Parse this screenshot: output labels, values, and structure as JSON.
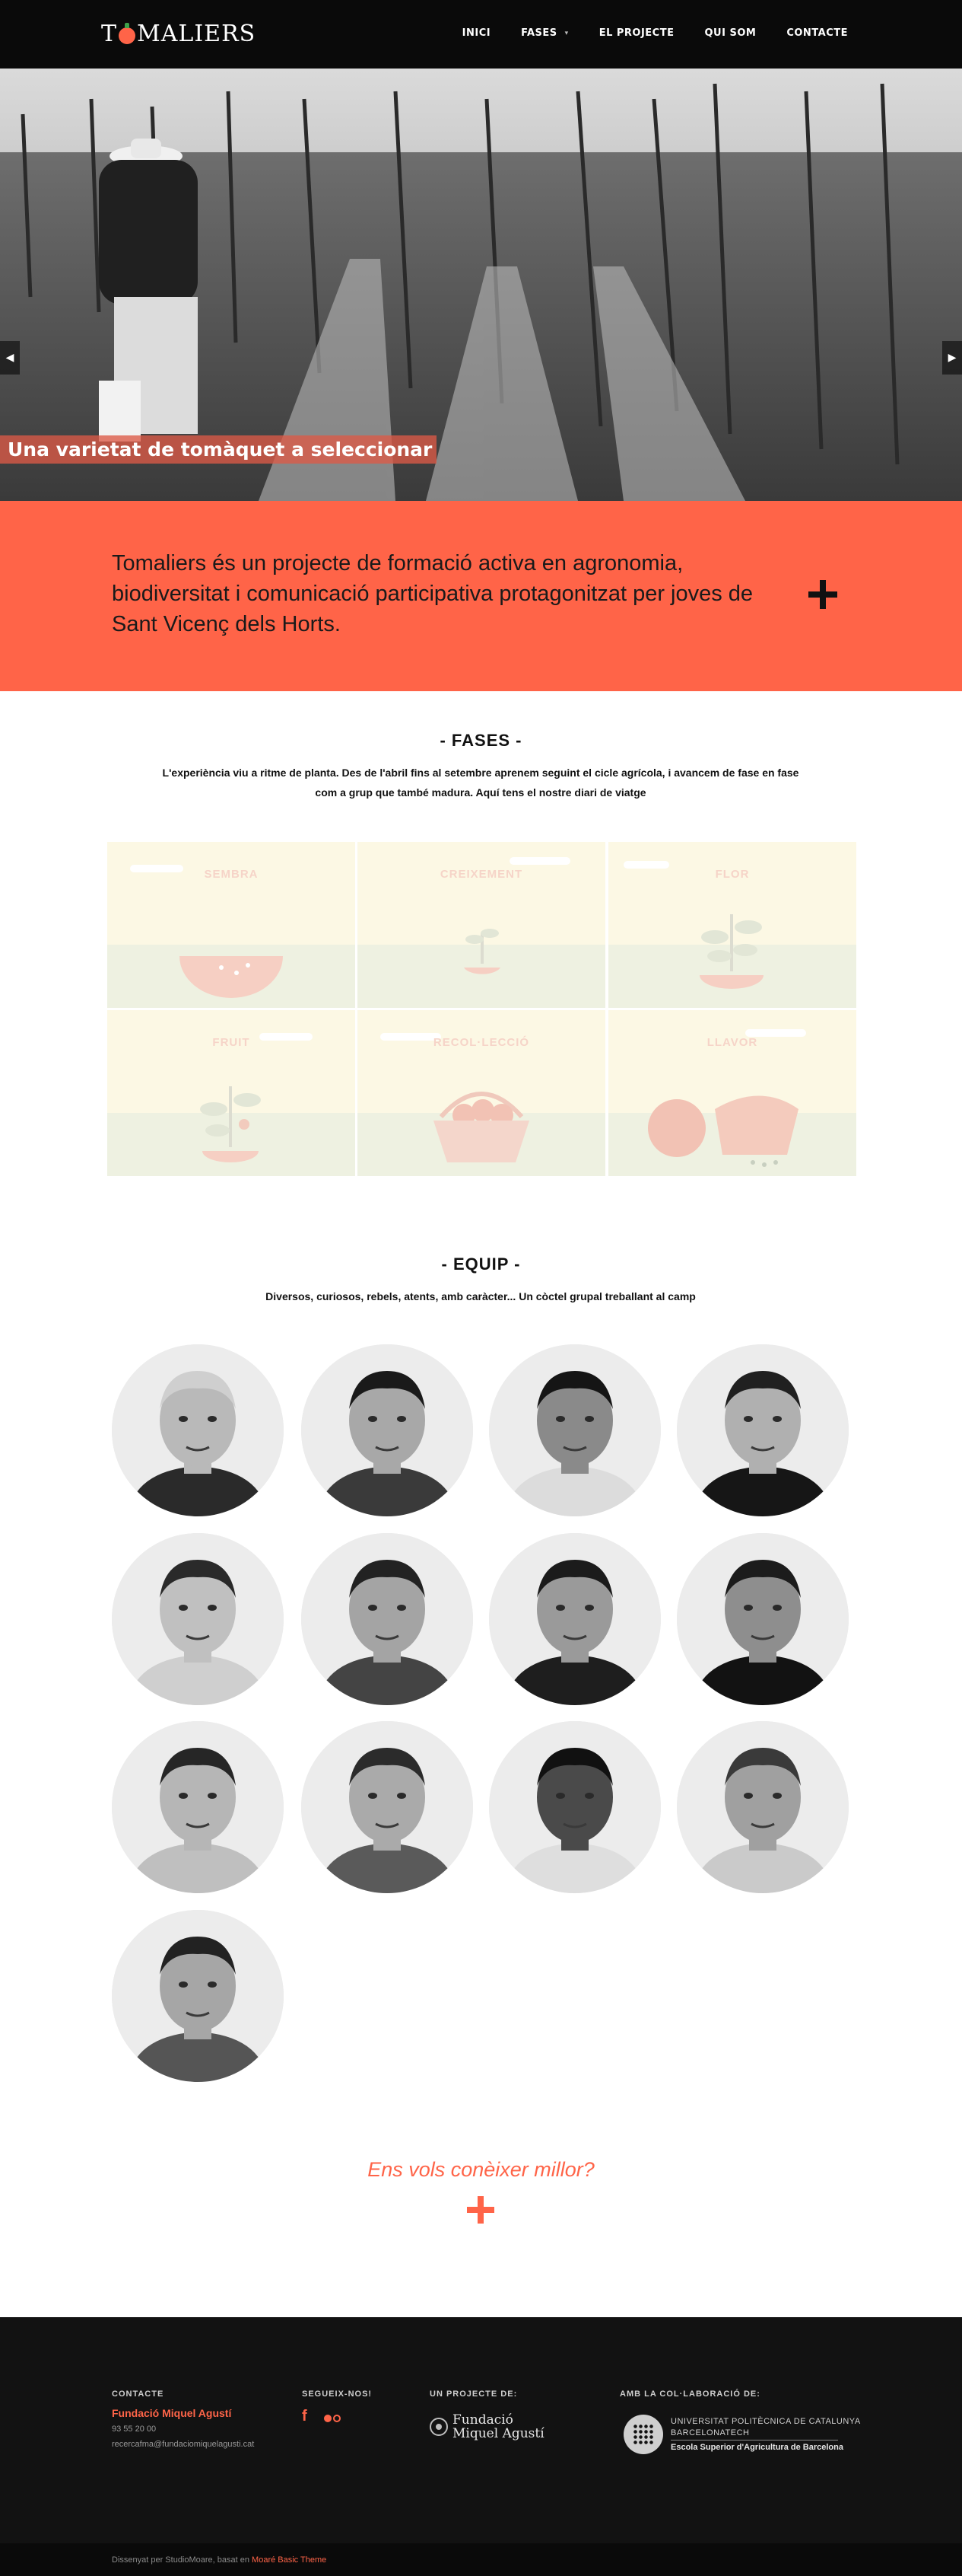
{
  "header": {
    "logo_text": "TOMALIERS",
    "nav": [
      {
        "label": "INICI"
      },
      {
        "label": "FASES",
        "has_dropdown": true
      },
      {
        "label": "EL PROJECTE"
      },
      {
        "label": "QUI SOM"
      },
      {
        "label": "CONTACTE"
      }
    ]
  },
  "hero": {
    "caption": "Una varietat de tomàquet a seleccionar",
    "prev_icon": "chevron-left-icon",
    "next_icon": "chevron-right-icon"
  },
  "intro": {
    "text": "Tomaliers és un projecte de formació activa en agronomia, biodiversitat i comunicació participativa protagonitzat per joves de Sant Vicenç dels Horts.",
    "expand_icon": "plus-icon"
  },
  "fases": {
    "title": "- FASES -",
    "subtitle": "L'experiència viu a ritme de planta. Des de l'abril fins al setembre aprenem seguint el cicle agrícola, i avancem de fase en fase com a grup que també madura. Aquí tens el nostre diari de viatge",
    "tiles": [
      {
        "label": "SEMBRA",
        "icon": "seed-bowl-icon"
      },
      {
        "label": "CREIXEMENT",
        "icon": "sprout-icon"
      },
      {
        "label": "FLOR",
        "icon": "flowering-plant-icon"
      },
      {
        "label": "FRUIT",
        "icon": "fruiting-plant-icon"
      },
      {
        "label": "RECOL·LECCIÓ",
        "icon": "harvest-basket-icon"
      },
      {
        "label": "LLAVOR",
        "icon": "sliced-tomato-icon"
      }
    ]
  },
  "equip": {
    "title": "- EQUIP -",
    "subtitle": "Diversos, curiosos, rebels, atents, amb caràcter... Un còctel grupal treballant al camp",
    "member_count": 13
  },
  "cta": {
    "text": "Ens vols conèixer millor?",
    "icon": "plus-icon"
  },
  "footer": {
    "contact_heading": "CONTACTE",
    "org_name": "Fundació Miquel Agustí",
    "phone": "93 55 20 00",
    "email": "recercafma@fundaciomiquelagusti.cat",
    "follow_heading": "SEGUEIX-NOS!",
    "social_icons": [
      "facebook-icon",
      "flickr-icon"
    ],
    "project_heading": "UN PROJECTE DE:",
    "fma_line1": "Fundació",
    "fma_line2": "Miquel Agustí",
    "collab_heading": "AMB LA COL·LABORACIÓ DE:",
    "upc_line1": "UNIVERSITAT POLITÈCNICA DE CATALUNYA",
    "upc_line2": "BARCELONATECH",
    "upc_line3": "Escola Superior d'Agricultura de Barcelona",
    "credit_prefix": "Dissenyat per StudioMoare, basat en ",
    "credit_link": "Moaré Basic Theme"
  },
  "colors": {
    "accent": "#ff6448",
    "header_bg": "#0a0a0a",
    "footer_bg": "#121212"
  }
}
